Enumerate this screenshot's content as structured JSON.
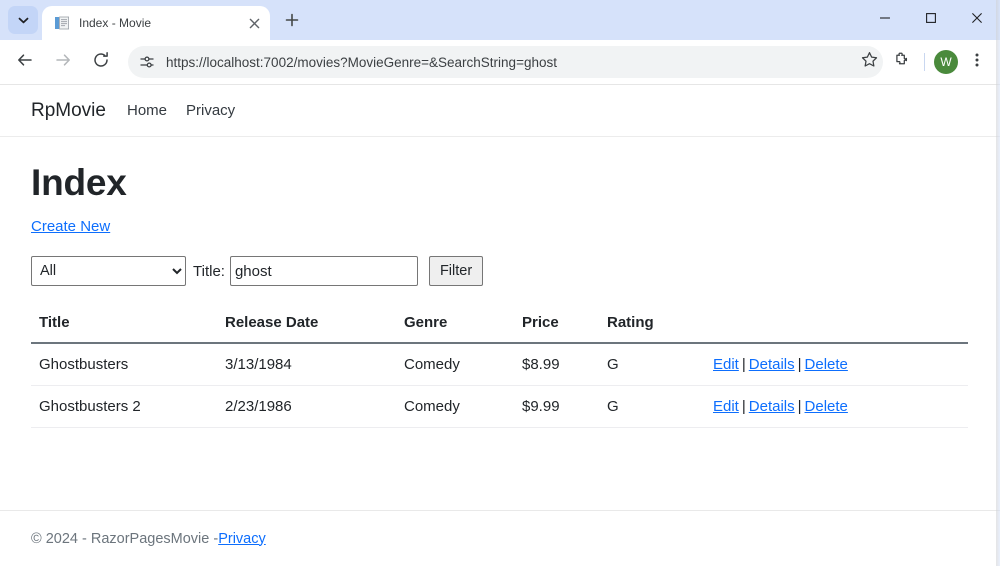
{
  "browser": {
    "tab": {
      "title": "Index - Movie",
      "favicon_icon": "document-icon",
      "close_icon": "close-icon"
    },
    "tab_search_icon": "chevron-down-icon",
    "new_tab_icon": "plus-icon",
    "window_controls": {
      "minimize_icon": "minimize-icon",
      "maximize_icon": "maximize-icon",
      "close_icon": "close-icon"
    },
    "toolbar": {
      "back_icon": "arrow-left-icon",
      "forward_icon": "arrow-right-icon",
      "reload_icon": "reload-icon",
      "site_info_icon": "tune-icon",
      "url": "https://localhost:7002/movies?MovieGenre=&SearchString=ghost",
      "bookmark_icon": "star-icon",
      "extensions_icon": "puzzle-piece-icon",
      "menu_icon": "three-dots-vertical-icon",
      "avatar_initial": "W",
      "avatar_color": "#4a8a3c"
    }
  },
  "site": {
    "brand": "RpMovie",
    "nav": [
      {
        "label": "Home"
      },
      {
        "label": "Privacy"
      }
    ],
    "heading": "Index",
    "create_new_label": "Create New",
    "filter": {
      "genre_selected": "All",
      "genre_options": [
        "All"
      ],
      "title_label": "Title:",
      "search_value": "ghost",
      "search_placeholder": "",
      "filter_button": "Filter"
    },
    "table": {
      "headers": [
        "Title",
        "Release Date",
        "Genre",
        "Price",
        "Rating"
      ],
      "rows": [
        {
          "title": "Ghostbusters",
          "release_date": "3/13/1984",
          "genre": "Comedy",
          "price": "$8.99",
          "rating": "G",
          "actions": {
            "edit": "Edit",
            "details": "Details",
            "delete": "Delete",
            "separator": "|"
          }
        },
        {
          "title": "Ghostbusters 2",
          "release_date": "2/23/1986",
          "genre": "Comedy",
          "price": "$9.99",
          "rating": "G",
          "actions": {
            "edit": "Edit",
            "details": "Details",
            "delete": "Delete",
            "separator": "|"
          }
        }
      ]
    },
    "footer": {
      "copyright": "© 2024 - RazorPagesMovie - ",
      "privacy_label": "Privacy"
    },
    "colors": {
      "link": "#0d6efd",
      "titlebar": "#d6e2fa"
    }
  }
}
